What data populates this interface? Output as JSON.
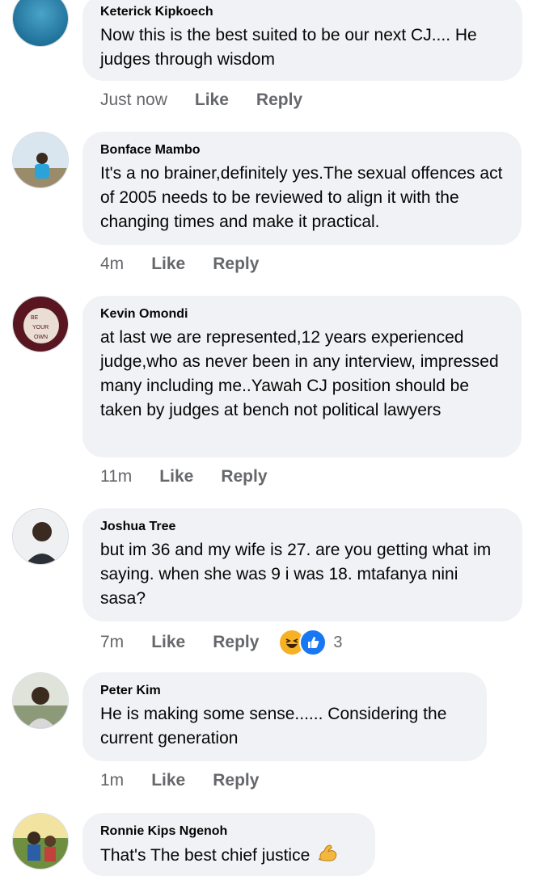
{
  "comments": [
    {
      "author": "Keterick Kipkoech",
      "text": "Now this is the best suited to be our next CJ.... He judges through wisdom",
      "time": "Just now",
      "like": "Like",
      "reply": "Reply"
    },
    {
      "author": "Bonface Mambo",
      "text": "It's a no brainer,definitely yes.The sexual offences act of 2005 needs to be reviewed to align it with the changing times and make it practical.",
      "time": "4m",
      "like": "Like",
      "reply": "Reply"
    },
    {
      "author": "Kevin Omondi",
      "text": "at last we are represented,12 years experienced judge,who as never been in any interview, impressed many including me..Yawah CJ position should be taken by judges at bench not political lawyers",
      "time": "11m",
      "like": "Like",
      "reply": "Reply"
    },
    {
      "author": "Joshua Tree",
      "text": "but im 36 and my wife is 27. are you getting what im saying. when she was 9 i was 18. mtafanya nini sasa?",
      "time": "7m",
      "like": "Like",
      "reply": "Reply",
      "reaction_count": "3",
      "reactions": [
        "haha-icon",
        "like-icon"
      ]
    },
    {
      "author": "Peter Kim",
      "text": "He is making some sense...... Considering the current generation",
      "time": "1m",
      "like": "Like",
      "reply": "Reply"
    },
    {
      "author": "Ronnie Kips Ngenoh",
      "text": "That's The best chief justice",
      "emoji": "flexed-biceps-icon"
    }
  ],
  "colors": {
    "bubble": "#f0f2f5",
    "secondary_text": "#65676b",
    "like_blue": "#1877f2",
    "haha_yellow": "#f7b125"
  }
}
